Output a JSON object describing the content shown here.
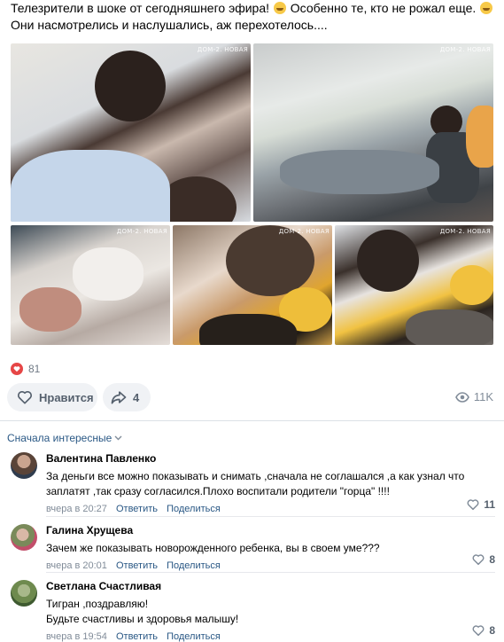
{
  "post": {
    "line1_part1": "Телезрители в шоке от сегодняшнего эфира!",
    "line1_part2": "Особенно те, кто не рожал еще.",
    "line2": "Они насмотрелись и наслушались, аж перехотелось....",
    "emoji_names": [
      "grinning-face-emoji",
      "grinning-sweat-emoji"
    ]
  },
  "photos": {
    "watermark": "ДОМ-2. НОВАЯ",
    "alts": [
      "photo-1",
      "photo-2",
      "photo-3",
      "photo-4",
      "photo-5"
    ]
  },
  "reactions": {
    "likes_count": "81",
    "like_button_label": "Нравится",
    "share_count": "4",
    "views_count": "11K",
    "heart_color": "#e64646"
  },
  "comments_sort": {
    "label": "Сначала интересные"
  },
  "comments": [
    {
      "author": "Валентина Павленко",
      "line1": "За деньги все можно показывать и снимать ,сначала не соглашался ,а как узнал что",
      "line2": "заплатят ,так сразу согласился.Плохо воспитали родители \"горца\" !!!!",
      "time": "вчера в 20:27",
      "reply_label": "Ответить",
      "share_label": "Поделиться",
      "likes": "11"
    },
    {
      "author": "Галина Хрущева",
      "line1": "Зачем же показывать новорожденного ребенка, вы в своем уме???",
      "time": "вчера в 20:01",
      "reply_label": "Ответить",
      "share_label": "Поделиться",
      "likes": "8"
    },
    {
      "author": "Светлана Счастливая",
      "line1": "Тигран ,поздравляю!",
      "line2": "Будьте счастливы и здоровья малышу!",
      "time": "вчера в 19:54",
      "reply_label": "Ответить",
      "share_label": "Поделиться",
      "likes": "8"
    }
  ],
  "colors": {
    "link": "#2a5885",
    "muted": "#818c99",
    "button_bg": "#f0f2f5"
  }
}
